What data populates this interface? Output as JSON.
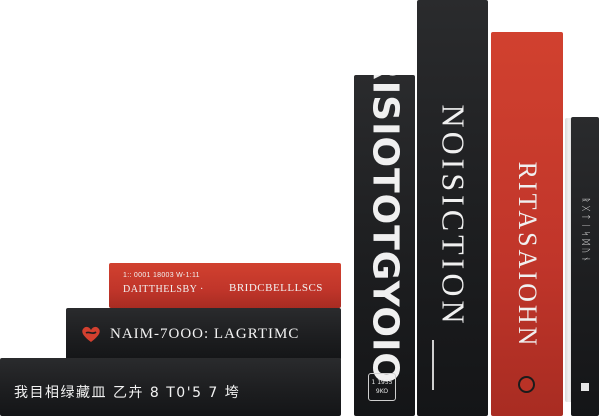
{
  "books": {
    "red_top": {
      "line1": "1:: 0001 18003 W-1:11",
      "line2": "DAITTHELSBY  ·",
      "line3": "BRIDCBELLLSCS"
    },
    "black_mid": {
      "title": "NAIM-7OOO:  LAGRTIMC"
    },
    "black_bottom": {
      "title": "我目相绿藏皿 乙卉 8 T0'5  7 垮"
    },
    "vertical_1": {
      "title": "RISIOTOTGYOIO",
      "badge_line1": "1 1955",
      "badge_line2": "9KO"
    },
    "vertical_2": {
      "title": "NOISICTION"
    },
    "vertical_3": {
      "title": "RITASAIOHN"
    },
    "vertical_5": {
      "title": "ᚱᚷᛏᛁᛋᛞᚢᚾ"
    }
  },
  "colors": {
    "black": "#1d1e20",
    "red": "#c0352a",
    "pale": "#efefef",
    "text": "#f2f2f2"
  }
}
